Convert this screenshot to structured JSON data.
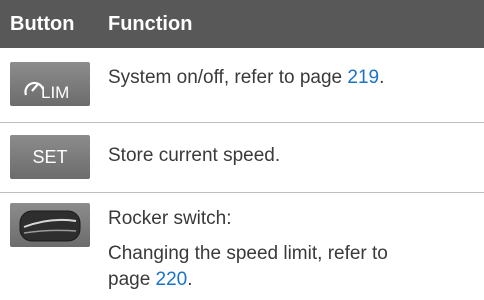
{
  "header": {
    "col_button": "Button",
    "col_function": "Function"
  },
  "rows": [
    {
      "icon": "speed-limiter-icon",
      "icon_label": "LIM",
      "text_before": "System on/off, refer to page ",
      "page": "219",
      "text_after": "."
    },
    {
      "icon": "set-button-icon",
      "icon_label": "SET",
      "text": "Store current speed."
    },
    {
      "icon": "rocker-switch-icon",
      "line1": "Rocker switch:",
      "line2": "Changing the speed limit, refer to",
      "line3_before": "page ",
      "page": "220",
      "line3_after": "."
    }
  ],
  "colors": {
    "header_bg": "#585858",
    "link": "#1a73c9",
    "divider": "#bdbdbd"
  }
}
